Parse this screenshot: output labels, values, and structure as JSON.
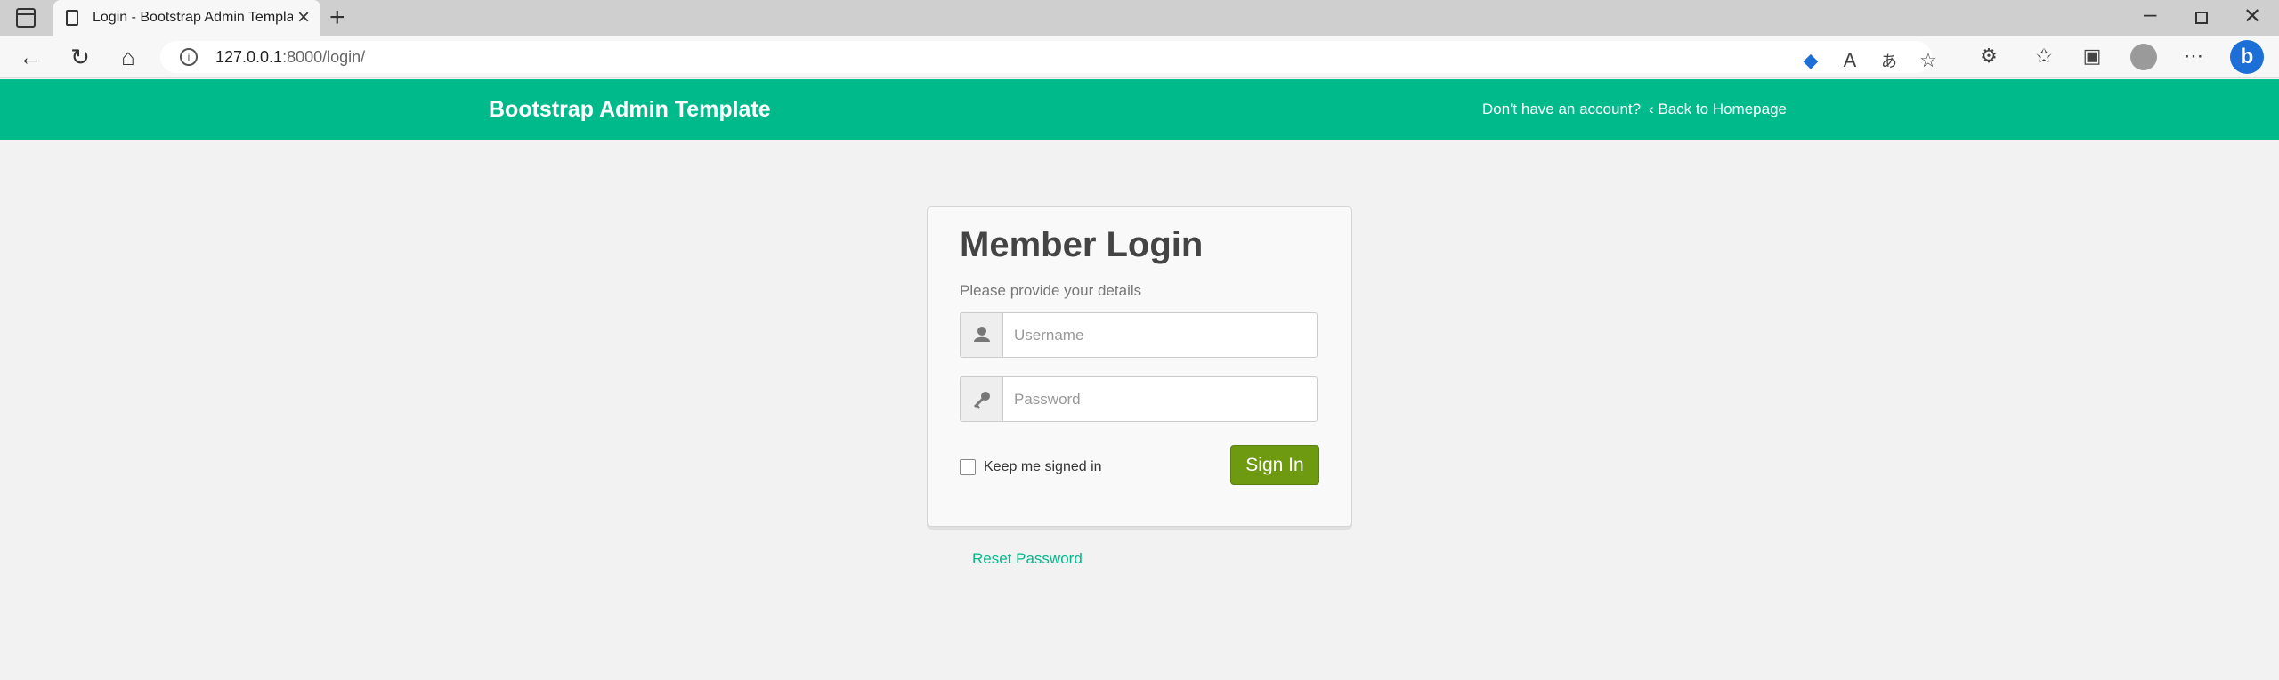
{
  "browser": {
    "tab_title": "Login - Bootstrap Admin Template",
    "url_host": "127.0.0.1",
    "url_path": ":8000/login/",
    "icons": [
      "sidebar-icon",
      "page-icon",
      "close-icon",
      "plus-icon",
      "back-arrow-icon",
      "refresh-icon",
      "home-icon",
      "info-icon",
      "tag-icon",
      "read-aloud-icon",
      "translate-icon",
      "add-favorite-icon",
      "extensions-icon",
      "favorites-icon",
      "collections-icon",
      "profile-icon",
      "more-icon",
      "bing-icon"
    ]
  },
  "navbar": {
    "brand": "Bootstrap Admin Template",
    "signup_link": "Don't have an account?",
    "back_link": "Back to Homepage",
    "background": "#00ba8b"
  },
  "login": {
    "title": "Member Login",
    "subtitle": "Please provide your details",
    "username_placeholder": "Username",
    "password_placeholder": "Password",
    "remember_label": "Keep me signed in",
    "remember_checked": false,
    "signin_label": "Sign In",
    "signin_color": "#6e9a11"
  },
  "reset_link": "Reset Password"
}
